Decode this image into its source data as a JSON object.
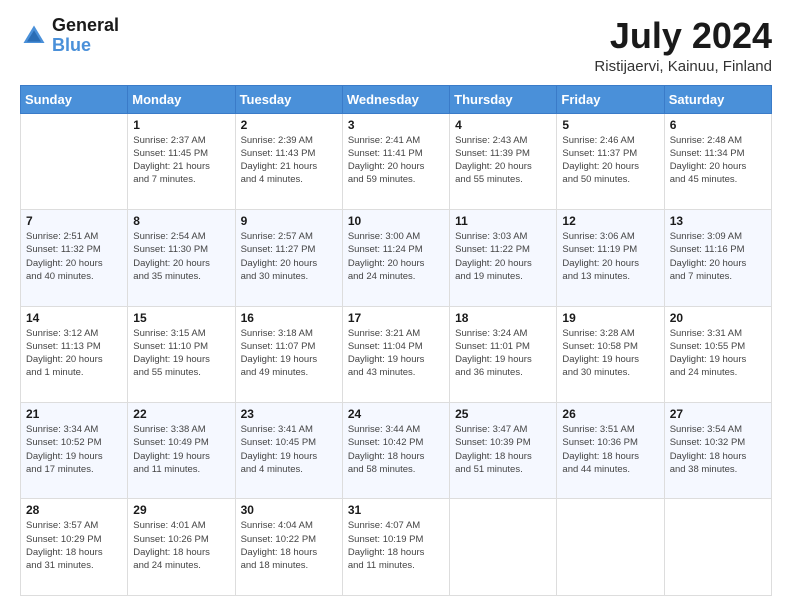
{
  "header": {
    "logo_line1": "General",
    "logo_line2": "Blue",
    "title": "July 2024",
    "subtitle": "Ristijaervi, Kainuu, Finland"
  },
  "days_of_week": [
    "Sunday",
    "Monday",
    "Tuesday",
    "Wednesday",
    "Thursday",
    "Friday",
    "Saturday"
  ],
  "weeks": [
    [
      {
        "day": "",
        "info": ""
      },
      {
        "day": "1",
        "info": "Sunrise: 2:37 AM\nSunset: 11:45 PM\nDaylight: 21 hours\nand 7 minutes."
      },
      {
        "day": "2",
        "info": "Sunrise: 2:39 AM\nSunset: 11:43 PM\nDaylight: 21 hours\nand 4 minutes."
      },
      {
        "day": "3",
        "info": "Sunrise: 2:41 AM\nSunset: 11:41 PM\nDaylight: 20 hours\nand 59 minutes."
      },
      {
        "day": "4",
        "info": "Sunrise: 2:43 AM\nSunset: 11:39 PM\nDaylight: 20 hours\nand 55 minutes."
      },
      {
        "day": "5",
        "info": "Sunrise: 2:46 AM\nSunset: 11:37 PM\nDaylight: 20 hours\nand 50 minutes."
      },
      {
        "day": "6",
        "info": "Sunrise: 2:48 AM\nSunset: 11:34 PM\nDaylight: 20 hours\nand 45 minutes."
      }
    ],
    [
      {
        "day": "7",
        "info": "Sunrise: 2:51 AM\nSunset: 11:32 PM\nDaylight: 20 hours\nand 40 minutes."
      },
      {
        "day": "8",
        "info": "Sunrise: 2:54 AM\nSunset: 11:30 PM\nDaylight: 20 hours\nand 35 minutes."
      },
      {
        "day": "9",
        "info": "Sunrise: 2:57 AM\nSunset: 11:27 PM\nDaylight: 20 hours\nand 30 minutes."
      },
      {
        "day": "10",
        "info": "Sunrise: 3:00 AM\nSunset: 11:24 PM\nDaylight: 20 hours\nand 24 minutes."
      },
      {
        "day": "11",
        "info": "Sunrise: 3:03 AM\nSunset: 11:22 PM\nDaylight: 20 hours\nand 19 minutes."
      },
      {
        "day": "12",
        "info": "Sunrise: 3:06 AM\nSunset: 11:19 PM\nDaylight: 20 hours\nand 13 minutes."
      },
      {
        "day": "13",
        "info": "Sunrise: 3:09 AM\nSunset: 11:16 PM\nDaylight: 20 hours\nand 7 minutes."
      }
    ],
    [
      {
        "day": "14",
        "info": "Sunrise: 3:12 AM\nSunset: 11:13 PM\nDaylight: 20 hours\nand 1 minute."
      },
      {
        "day": "15",
        "info": "Sunrise: 3:15 AM\nSunset: 11:10 PM\nDaylight: 19 hours\nand 55 minutes."
      },
      {
        "day": "16",
        "info": "Sunrise: 3:18 AM\nSunset: 11:07 PM\nDaylight: 19 hours\nand 49 minutes."
      },
      {
        "day": "17",
        "info": "Sunrise: 3:21 AM\nSunset: 11:04 PM\nDaylight: 19 hours\nand 43 minutes."
      },
      {
        "day": "18",
        "info": "Sunrise: 3:24 AM\nSunset: 11:01 PM\nDaylight: 19 hours\nand 36 minutes."
      },
      {
        "day": "19",
        "info": "Sunrise: 3:28 AM\nSunset: 10:58 PM\nDaylight: 19 hours\nand 30 minutes."
      },
      {
        "day": "20",
        "info": "Sunrise: 3:31 AM\nSunset: 10:55 PM\nDaylight: 19 hours\nand 24 minutes."
      }
    ],
    [
      {
        "day": "21",
        "info": "Sunrise: 3:34 AM\nSunset: 10:52 PM\nDaylight: 19 hours\nand 17 minutes."
      },
      {
        "day": "22",
        "info": "Sunrise: 3:38 AM\nSunset: 10:49 PM\nDaylight: 19 hours\nand 11 minutes."
      },
      {
        "day": "23",
        "info": "Sunrise: 3:41 AM\nSunset: 10:45 PM\nDaylight: 19 hours\nand 4 minutes."
      },
      {
        "day": "24",
        "info": "Sunrise: 3:44 AM\nSunset: 10:42 PM\nDaylight: 18 hours\nand 58 minutes."
      },
      {
        "day": "25",
        "info": "Sunrise: 3:47 AM\nSunset: 10:39 PM\nDaylight: 18 hours\nand 51 minutes."
      },
      {
        "day": "26",
        "info": "Sunrise: 3:51 AM\nSunset: 10:36 PM\nDaylight: 18 hours\nand 44 minutes."
      },
      {
        "day": "27",
        "info": "Sunrise: 3:54 AM\nSunset: 10:32 PM\nDaylight: 18 hours\nand 38 minutes."
      }
    ],
    [
      {
        "day": "28",
        "info": "Sunrise: 3:57 AM\nSunset: 10:29 PM\nDaylight: 18 hours\nand 31 minutes."
      },
      {
        "day": "29",
        "info": "Sunrise: 4:01 AM\nSunset: 10:26 PM\nDaylight: 18 hours\nand 24 minutes."
      },
      {
        "day": "30",
        "info": "Sunrise: 4:04 AM\nSunset: 10:22 PM\nDaylight: 18 hours\nand 18 minutes."
      },
      {
        "day": "31",
        "info": "Sunrise: 4:07 AM\nSunset: 10:19 PM\nDaylight: 18 hours\nand 11 minutes."
      },
      {
        "day": "",
        "info": ""
      },
      {
        "day": "",
        "info": ""
      },
      {
        "day": "",
        "info": ""
      }
    ]
  ]
}
